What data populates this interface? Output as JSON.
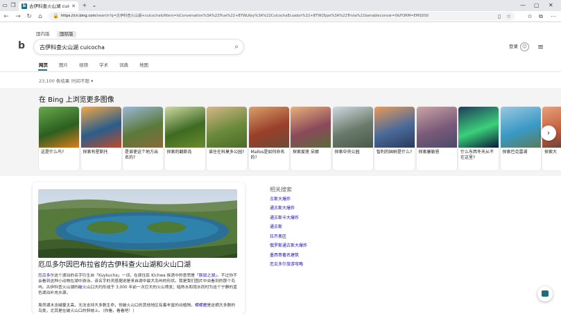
{
  "browser": {
    "tab_title": "古伊科查火山湖 cuicoch",
    "tab_close": "✕",
    "new_tab": "+",
    "tab_menu": "⌄",
    "url_host": "https://cn.bing.com",
    "url_rest": "/search?q=古伊科查火山湖+cuicocha&filters=IsConversation%3A%22True%22+BTWLKey%3A%22CuicochaEcuador%22+BTWLType%3A%22Trivia%22&enableconvar=0&FORM=EMSDS0"
  },
  "search": {
    "scopes": [
      "国内版",
      "国际版"
    ],
    "query": "古伊科查火山湖 cuicocha",
    "login": "登录",
    "tabs": [
      "网页",
      "图片",
      "视频",
      "学术",
      "词典",
      "地图"
    ],
    "result_count": "23,100 条结果",
    "time_filter": "时间不限 ▾"
  },
  "images": {
    "heading": "在 Bing 上浏览更多图像",
    "cards": [
      {
        "caption": "这是什么鸟?",
        "c1": "#6aa84f",
        "c2": "#2b5f1f",
        "c3": "#e07b1a"
      },
      {
        "caption": "探索有星斯托",
        "c1": "#f0a84a",
        "c2": "#2b5d8a",
        "c3": "#c04a2a"
      },
      {
        "caption": "是谁使这个地方出名的?",
        "c1": "#9bb7d6",
        "c2": "#5a7a3a",
        "c3": "#8a6a3a"
      },
      {
        "caption": "探索的翻斯岛",
        "c1": "#cfd8a3",
        "c2": "#3e6b22",
        "c3": "#6b8a2a"
      },
      {
        "caption": "谁住在科莫多公园?",
        "c1": "#d4b68a",
        "c2": "#6b8a3a",
        "c3": "#4a6a2a"
      },
      {
        "caption": "Mallos是如何命名的?",
        "c1": "#d7a06a",
        "c2": "#9a3f2a",
        "c3": "#6a4a3a"
      },
      {
        "caption": "探索爱莲 朵娜",
        "c1": "#e8b07a",
        "c2": "#8a4a5a",
        "c3": "#5a6a3a"
      },
      {
        "caption": "探索中央公园",
        "c1": "#cfd8e0",
        "c2": "#6a7a6a",
        "c3": "#4a5a4a"
      },
      {
        "caption": "智利的国树是什么?",
        "c1": "#e89a5a",
        "c2": "#4a6a9a",
        "c3": "#2a3a5a"
      },
      {
        "caption": "探索康勒恩",
        "c1": "#c9a4a4",
        "c2": "#7a5a7a",
        "c3": "#4a4a6a"
      },
      {
        "caption": "什么东西冬天从不在这里?",
        "c1": "#1f3a5a",
        "c2": "#3ad07a",
        "c3": "#0a1a3a"
      },
      {
        "caption": "探索巴克雷湖",
        "c1": "#9ac6e0",
        "c2": "#3a9ac6",
        "c3": "#5a7a5a"
      },
      {
        "caption": "探索大",
        "c1": "#e8a07a",
        "c2": "#c05a3a",
        "c3": "#3a3a3a"
      }
    ]
  },
  "answer": {
    "title": "厄瓜多尔因巴布拉省的古伊科查火山湖和火山口湖",
    "p1_a": "厄瓜多尔",
    "p1_b": "这个湖泊的名字衍生自「Kuykucha」一词，在原住民 Kichwa 族语中的意思是「",
    "p1_c": "豚鼠之湖",
    "p1_d": "」。不过你不会看到这种小动物在湖中游泳。该名字的灵感据说是来自湖中最大岛屿的形状。我是我们图片中央看到的那个岛屿。古伊科查火山湖的",
    "p1_e": "破火山口",
    "p1_f": "大约形成于 3,000 年前一次巨大的火山喷发；暗熟水和雨水同时为这个宁静的蓝色湖泊补充水源。",
    "p2_a": "虽然湖水含碱量太高，无法支持大多数生命，但破火山口的其他地区有着丰富的动植物。",
    "p2_b": "蝶蝶雁",
    "p2_c": "是这栖大多数的鸟类，尤其是在破火山口的斜坡上。（你看，看看吧！）"
  },
  "related": {
    "title": "相关搜索",
    "items": [
      "古斯大爆炸",
      "通古斯大爆炸",
      "通古斯卡大爆炸",
      "通古斯",
      "拉齐奥区",
      "俄罗斯通古斯大爆炸",
      "墨西哥著名建筑",
      "厄瓜多尔旅游攻略"
    ]
  },
  "colors": {
    "accent": "#1a6e7e",
    "link": "#1a0dab"
  }
}
